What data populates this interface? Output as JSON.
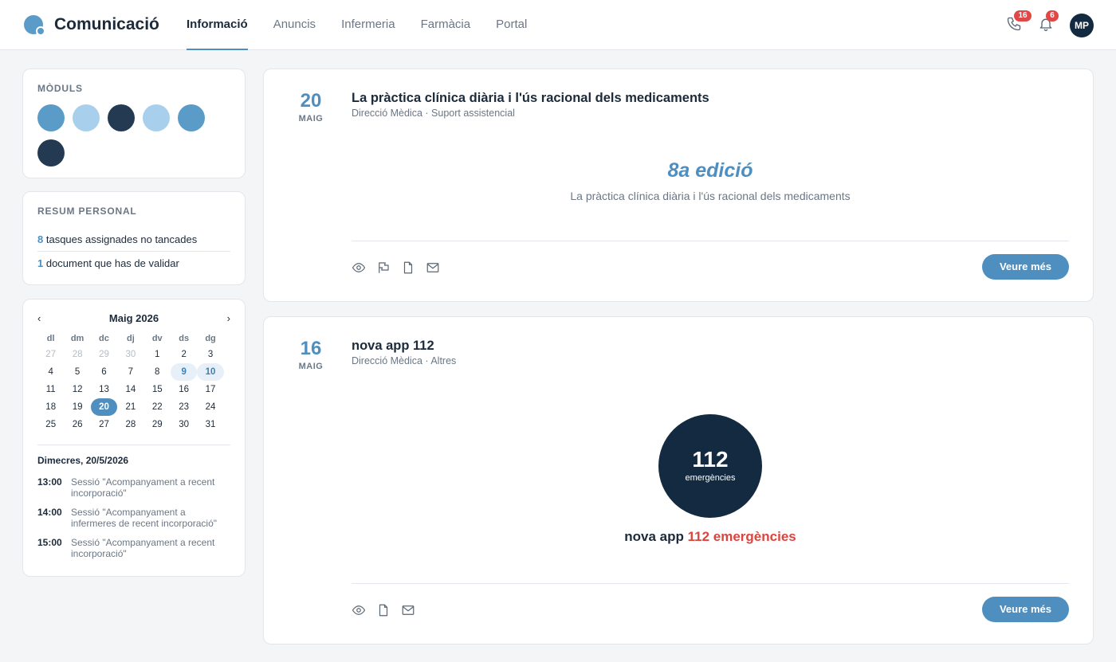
{
  "app": {
    "title": "Comunicació"
  },
  "nav": {
    "tabs": [
      {
        "label": "Informació",
        "active": true
      },
      {
        "label": "Anuncis"
      },
      {
        "label": "Infermeria"
      },
      {
        "label": "Farmàcia"
      },
      {
        "label": "Portal"
      }
    ]
  },
  "header": {
    "calls_badge": "16",
    "notifications_badge": "6",
    "avatar_initials": "MP",
    "icons": [
      "phone-icon",
      "bell-icon"
    ]
  },
  "moduls": {
    "title": "MÒDULS",
    "colors": [
      "#5b9bc7",
      "#a8cfeb",
      "#243a52",
      "#a8cfeb",
      "#5b9bc7",
      "#243a52"
    ]
  },
  "resum": {
    "title": "RESUM PERSONAL",
    "tasks_count": "8",
    "tasks_text": " tasques assignades no tancades",
    "docs_count": "1",
    "docs_text": " document que has de validar"
  },
  "calendar": {
    "prev": "‹",
    "next": "›",
    "month": "Maig 2026",
    "dow": [
      "dl",
      "dm",
      "dc",
      "dj",
      "dv",
      "ds",
      "dg"
    ],
    "days": [
      [
        "27",
        "28",
        "29",
        "30",
        "1",
        "2",
        "3"
      ],
      [
        "4",
        "5",
        "6",
        "7",
        "8",
        "9",
        "10"
      ],
      [
        "11",
        "12",
        "13",
        "14",
        "15",
        "16",
        "17"
      ],
      [
        "18",
        "19",
        "20",
        "21",
        "22",
        "23",
        "24"
      ],
      [
        "25",
        "26",
        "27",
        "28",
        "29",
        "30",
        "31"
      ]
    ],
    "today": "20",
    "highlighted": [
      "9",
      "10"
    ],
    "selected_date": "Dimecres, 20/5/2026",
    "events": [
      {
        "time": "13:00",
        "text": "Sessió \"Acompanyament a recent incorporació\""
      },
      {
        "time": "14:00",
        "text": "Sessió \"Acompanyament a infermeres de recent incorporació\""
      },
      {
        "time": "15:00",
        "text": "Sessió \"Acompanyament a recent incorporació\""
      }
    ]
  },
  "posts": [
    {
      "day": "20",
      "month": "MAIG",
      "title": "La pràctica clínica diària i l'ús racional dels medicaments",
      "meta": "Direcció Mèdica · Suport assistencial",
      "hero_title": "8a edició",
      "hero_subtitle": "La pràctica clínica diària i l'ús racional dels medicaments",
      "action_icons": [
        "eye-icon",
        "flag-icon",
        "document-icon",
        "mail-icon"
      ],
      "button": "Veure més"
    },
    {
      "day": "16",
      "month": "MAIG",
      "title": "nova app 112",
      "meta": "Direcció Mèdica · Altres",
      "circle_number": "112",
      "circle_label": "emergències",
      "caption_prefix": "nova app ",
      "caption_highlight": "112 emergències",
      "action_icons": [
        "eye-icon",
        "document-icon",
        "mail-icon"
      ],
      "button": "Veure més"
    }
  ],
  "colors": {
    "accent": "#4f8fc0",
    "dark": "#142a40",
    "badge": "#e04848",
    "highlight_red": "#d9463f"
  }
}
